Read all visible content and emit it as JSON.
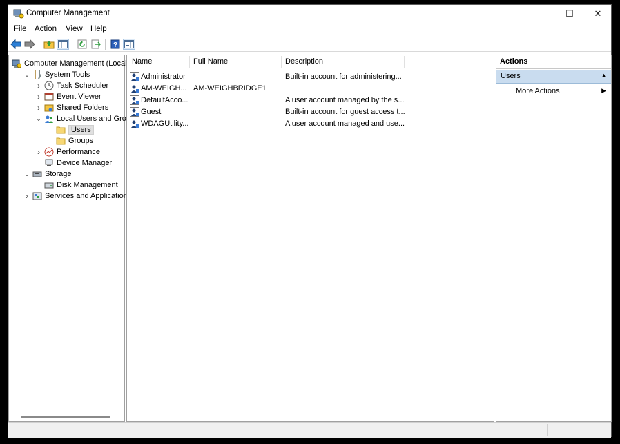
{
  "window": {
    "title": "Computer Management"
  },
  "menu": [
    "File",
    "Action",
    "View",
    "Help"
  ],
  "toolbar": {
    "buttons": [
      "back-arrow-icon",
      "forward-arrow-icon",
      "up-folder-icon",
      "show-hide-tree-icon",
      "refresh-icon",
      "export-list-icon",
      "help-icon",
      "show-action-pane-icon"
    ]
  },
  "tree": [
    {
      "label": "Computer Management (Local",
      "icon": "computer-management-icon",
      "level": 0,
      "chevron": ""
    },
    {
      "label": "System Tools",
      "icon": "tools-icon",
      "level": 1,
      "chevron": "down"
    },
    {
      "label": "Task Scheduler",
      "icon": "clock-icon",
      "level": 2,
      "chevron": "right"
    },
    {
      "label": "Event Viewer",
      "icon": "event-viewer-icon",
      "level": 2,
      "chevron": "right"
    },
    {
      "label": "Shared Folders",
      "icon": "shared-folder-icon",
      "level": 2,
      "chevron": "right"
    },
    {
      "label": "Local Users and Groups",
      "icon": "users-icon",
      "level": 2,
      "chevron": "down"
    },
    {
      "label": "Users",
      "icon": "folder-icon",
      "level": 3,
      "chevron": "",
      "selected": true
    },
    {
      "label": "Groups",
      "icon": "folder-icon",
      "level": 3,
      "chevron": ""
    },
    {
      "label": "Performance",
      "icon": "performance-icon",
      "level": 2,
      "chevron": "right"
    },
    {
      "label": "Device Manager",
      "icon": "device-manager-icon",
      "level": 2,
      "chevron": ""
    },
    {
      "label": "Storage",
      "icon": "storage-icon",
      "level": 1,
      "chevron": "down"
    },
    {
      "label": "Disk Management",
      "icon": "disk-icon",
      "level": 2,
      "chevron": ""
    },
    {
      "label": "Services and Applications",
      "icon": "services-icon",
      "level": 1,
      "chevron": "right"
    }
  ],
  "list": {
    "columns": [
      "Name",
      "Full Name",
      "Description"
    ],
    "rows": [
      {
        "name": "Administrator",
        "full_name": "",
        "description": "Built-in account for administering..."
      },
      {
        "name": "AM-WEIGH...",
        "full_name": "AM-WEIGHBRIDGE1",
        "description": ""
      },
      {
        "name": "DefaultAcco...",
        "full_name": "",
        "description": "A user account managed by the s..."
      },
      {
        "name": "Guest",
        "full_name": "",
        "description": "Built-in account for guest access t..."
      },
      {
        "name": "WDAGUtility...",
        "full_name": "",
        "description": "A user account managed and use..."
      }
    ]
  },
  "actions": {
    "title": "Actions",
    "section": "Users",
    "items": [
      "More Actions"
    ]
  },
  "colors": {
    "selection": "#c9dcef",
    "accent": "#0078d7"
  }
}
